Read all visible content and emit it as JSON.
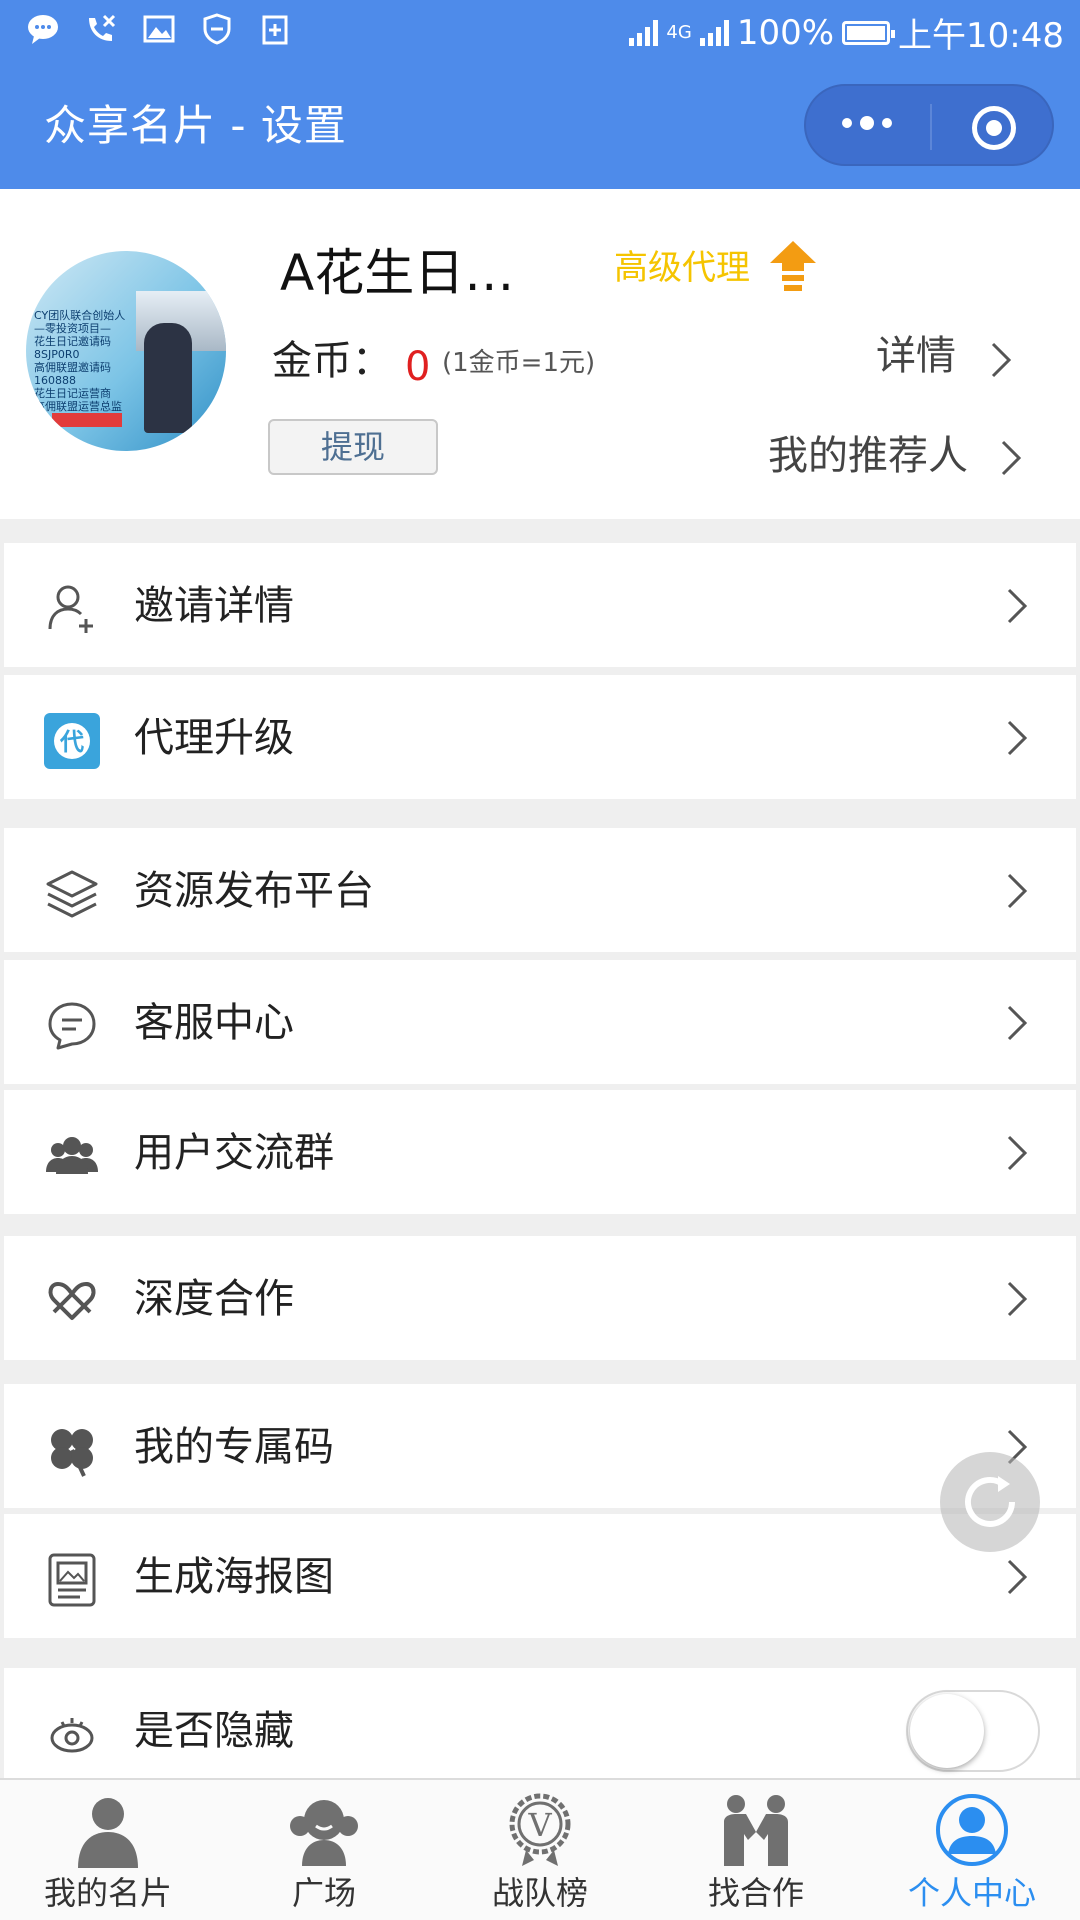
{
  "status_bar": {
    "battery": "100%",
    "network": "4G",
    "time": "上午10:48"
  },
  "header": {
    "title": "众享名片 - 设置",
    "more_icon": "more-dots-icon",
    "target_icon": "record-target-icon"
  },
  "profile": {
    "name": "A花生日…",
    "level": "高级代理",
    "coin_label": "金币：",
    "coin_value": "0",
    "coin_rate": "(1金币=1元)",
    "detail": "详情",
    "withdraw": "提现",
    "referrer": "我的推荐人",
    "avatar_text": [
      "CY团队联合创始人",
      "—零投资项目—",
      "花生日记邀请码",
      "8SJP0R0",
      "高佣联盟邀请码",
      "160888",
      "花生日记运营商",
      "高佣联盟运营总监"
    ]
  },
  "menu": [
    {
      "label": "邀请详情",
      "icon": "user-add-icon"
    },
    {
      "label": "代理升级",
      "icon": "agent-badge-icon"
    },
    {
      "label": "资源发布平台",
      "icon": "layers-icon"
    },
    {
      "label": "客服中心",
      "icon": "chat-bubble-icon"
    },
    {
      "label": "用户交流群",
      "icon": "group-icon"
    },
    {
      "label": "深度合作",
      "icon": "cooperation-icon"
    },
    {
      "label": "我的专属码",
      "icon": "clover-icon"
    },
    {
      "label": "生成海报图",
      "icon": "poster-icon"
    },
    {
      "label": "是否隐藏",
      "icon": "eye-icon"
    }
  ],
  "hide_toggle": {
    "on": false
  },
  "tabs": [
    {
      "label": "我的名片",
      "icon": "person-icon"
    },
    {
      "label": "广场",
      "icon": "square-icon"
    },
    {
      "label": "战队榜",
      "icon": "v-badge-icon"
    },
    {
      "label": "找合作",
      "icon": "cooperation-people-icon"
    },
    {
      "label": "个人中心",
      "icon": "profile-circle-icon",
      "active": true
    }
  ],
  "colors": {
    "header_bg": "#4e8bea",
    "level": "#f5c400",
    "coin": "#e02020",
    "tab_active": "#2b8ef0",
    "agent_badge": "#3aa4dc"
  }
}
